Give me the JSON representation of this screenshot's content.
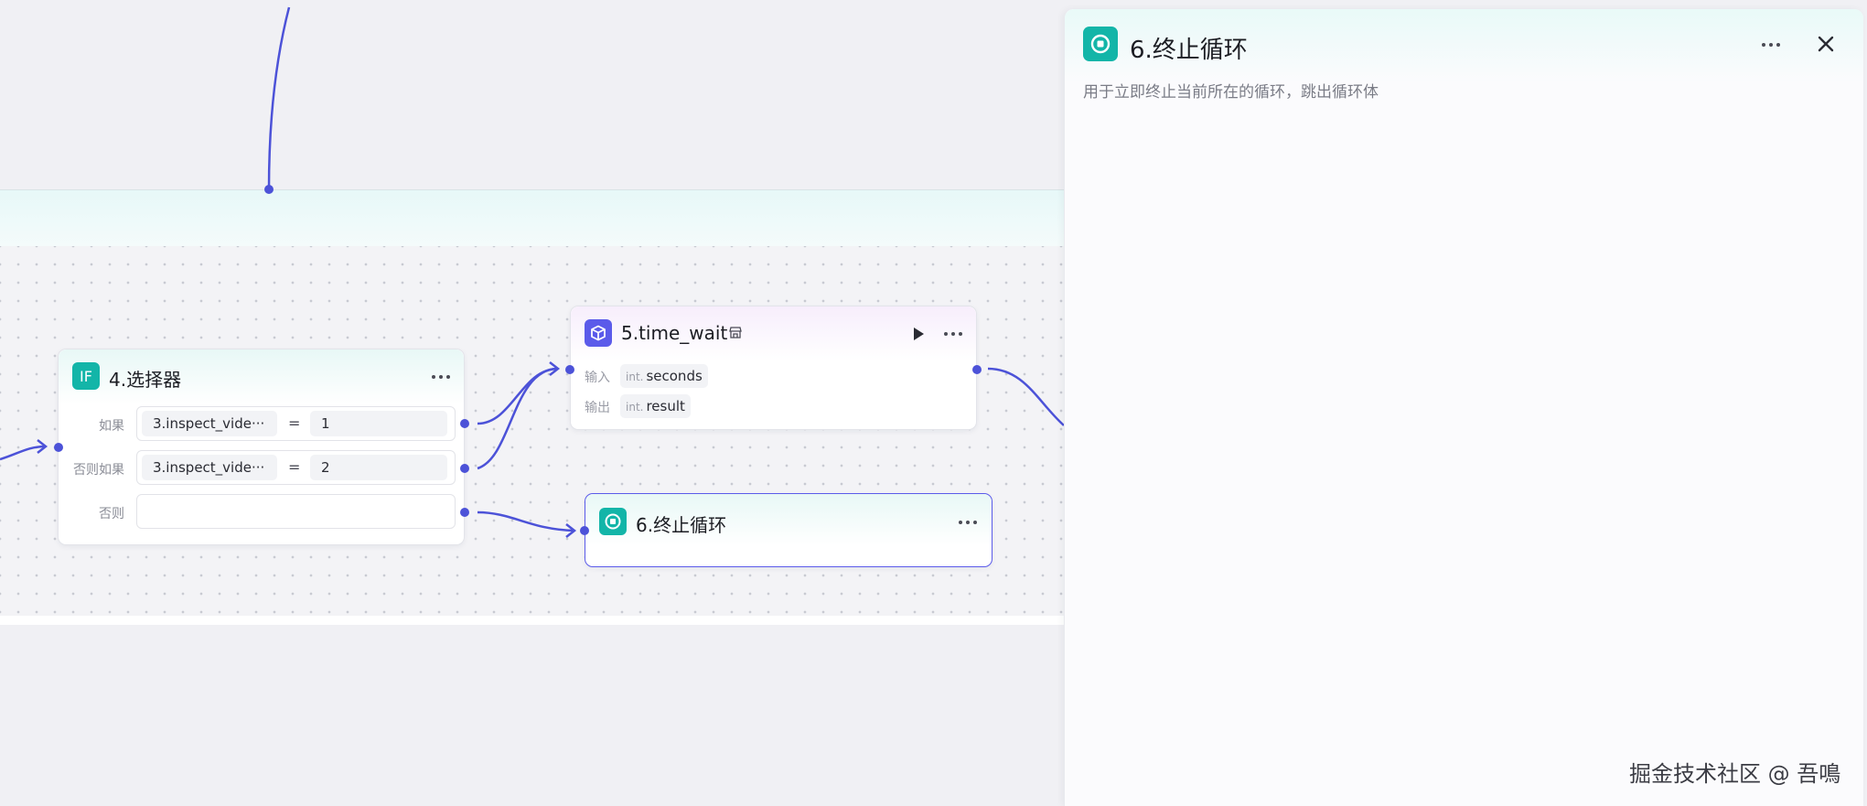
{
  "canvas": {
    "selector_node": {
      "title": "4.选择器",
      "icon": "if-icon",
      "rows": [
        {
          "label": "如果",
          "left": "3.inspect_vide···",
          "op": "=",
          "right": "1"
        },
        {
          "label": "否则如果",
          "left": "3.inspect_vide···",
          "op": "=",
          "right": "2"
        },
        {
          "label": "否则",
          "left": "",
          "op": "",
          "right": ""
        }
      ]
    },
    "time_wait_node": {
      "title": "5.time_wait",
      "icon": "cube-icon",
      "input_label": "输入",
      "output_label": "输出",
      "input": {
        "type": "int.",
        "name": "seconds"
      },
      "output": {
        "type": "int.",
        "name": "result"
      }
    },
    "terminate_node": {
      "title": "6.终止循环",
      "icon": "stop-circle-icon"
    },
    "colors": {
      "wire": "#4c52d8",
      "teal": "#13b5a8",
      "purple": "#5b5bea"
    }
  },
  "panel": {
    "title": "6.终止循环",
    "description": "用于立即终止当前所在的循环，跳出循环体",
    "icon": "stop-circle-icon"
  },
  "watermark": "掘金技术社区 @ 吾鳴"
}
